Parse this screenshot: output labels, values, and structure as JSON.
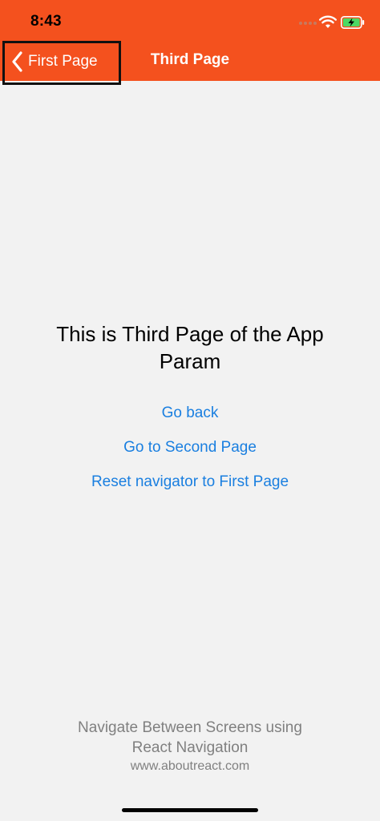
{
  "status_bar": {
    "time": "8:43",
    "wifi_icon": "wifi-icon",
    "battery_icon": "battery-charging-icon"
  },
  "header": {
    "background_color": "#f4511e",
    "back_label": "First Page",
    "title": "Third Page"
  },
  "content": {
    "main_text": "This is Third Page of the App",
    "param_text": "Param"
  },
  "links": {
    "go_back": "Go back",
    "go_to_second": "Go to Second Page",
    "reset_navigator": "Reset navigator to First Page",
    "color": "#1a7fe0"
  },
  "footer": {
    "line1": "Navigate Between Screens using",
    "line2": "React Navigation",
    "url": "www.aboutreact.com"
  }
}
